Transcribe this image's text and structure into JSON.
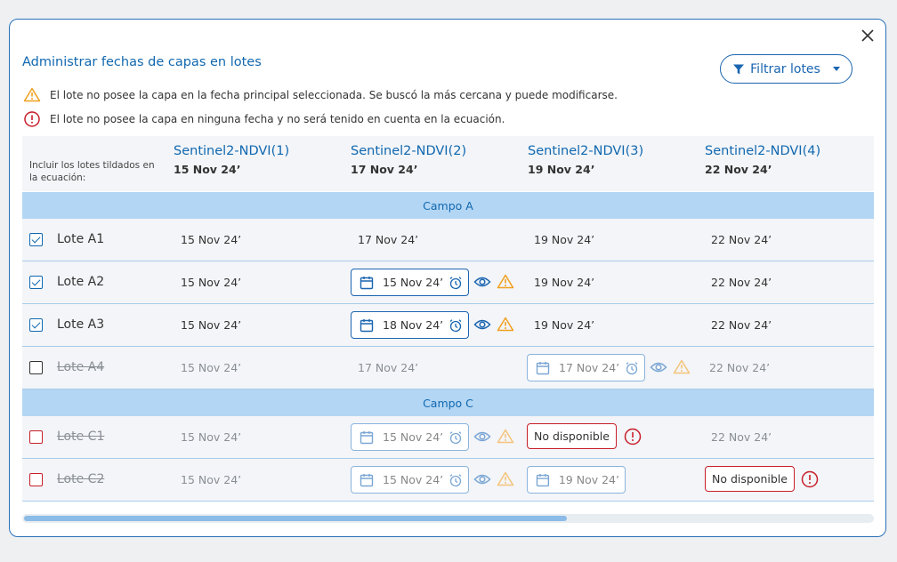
{
  "modal": {
    "title": "Administrar fechas de capas en lotes",
    "filter_label": "Filtrar lotes"
  },
  "legend": {
    "warning_text": "El lote no posee la capa en la fecha principal seleccionada. Se buscó la más cercana y puede modificarse.",
    "error_text": "El lote no posee la capa en ninguna fecha y no será tenido en cuenta en la ecuación."
  },
  "table": {
    "include_label": "Incluir los lotes tildados en la ecuación:",
    "columns": [
      {
        "name": "Sentinel2-NDVI(1)",
        "date": "15 Nov 24’"
      },
      {
        "name": "Sentinel2-NDVI(2)",
        "date": "17 Nov 24’"
      },
      {
        "name": "Sentinel2-NDVI(3)",
        "date": "19 Nov 24’"
      },
      {
        "name": "Sentinel2-NDVI(4)",
        "date": "22 Nov 24’"
      }
    ],
    "groups": [
      {
        "name": "Campo A"
      },
      {
        "name": "Campo C"
      }
    ],
    "rows": [
      {
        "name": "Lote A1",
        "c1": "15 Nov 24’",
        "c2": "17 Nov 24’",
        "c3": "19 Nov 24’",
        "c4": "22 Nov 24’"
      },
      {
        "name": "Lote A2",
        "c1": "15 Nov 24’",
        "c2": "15 Nov 24’",
        "c3": "19 Nov 24’",
        "c4": "22 Nov 24’"
      },
      {
        "name": "Lote A3",
        "c1": "15 Nov 24’",
        "c2": "18 Nov 24’",
        "c3": "19 Nov 24’",
        "c4": "22 Nov 24’"
      },
      {
        "name": "Lote A4",
        "c1": "15 Nov 24’",
        "c2": "17 Nov 24’",
        "c3": "17 Nov 24’",
        "c4": "22 Nov 24’"
      },
      {
        "name": "Lote C1",
        "c1": "15 Nov 24’",
        "c2": "15 Nov 24’",
        "c3": "No disponible",
        "c4": "22 Nov 24’"
      },
      {
        "name": "Lote C2",
        "c1": "15 Nov 24’",
        "c2": "15 Nov 24’",
        "c3": "19 Nov 24’",
        "c4": "No disponible"
      }
    ]
  },
  "scroll": {
    "position_fraction": 0.64
  },
  "colors": {
    "primary": "#1168b0",
    "group_bg": "#b3d6f4",
    "warning": "#f0a020",
    "error": "#c81e2a"
  }
}
